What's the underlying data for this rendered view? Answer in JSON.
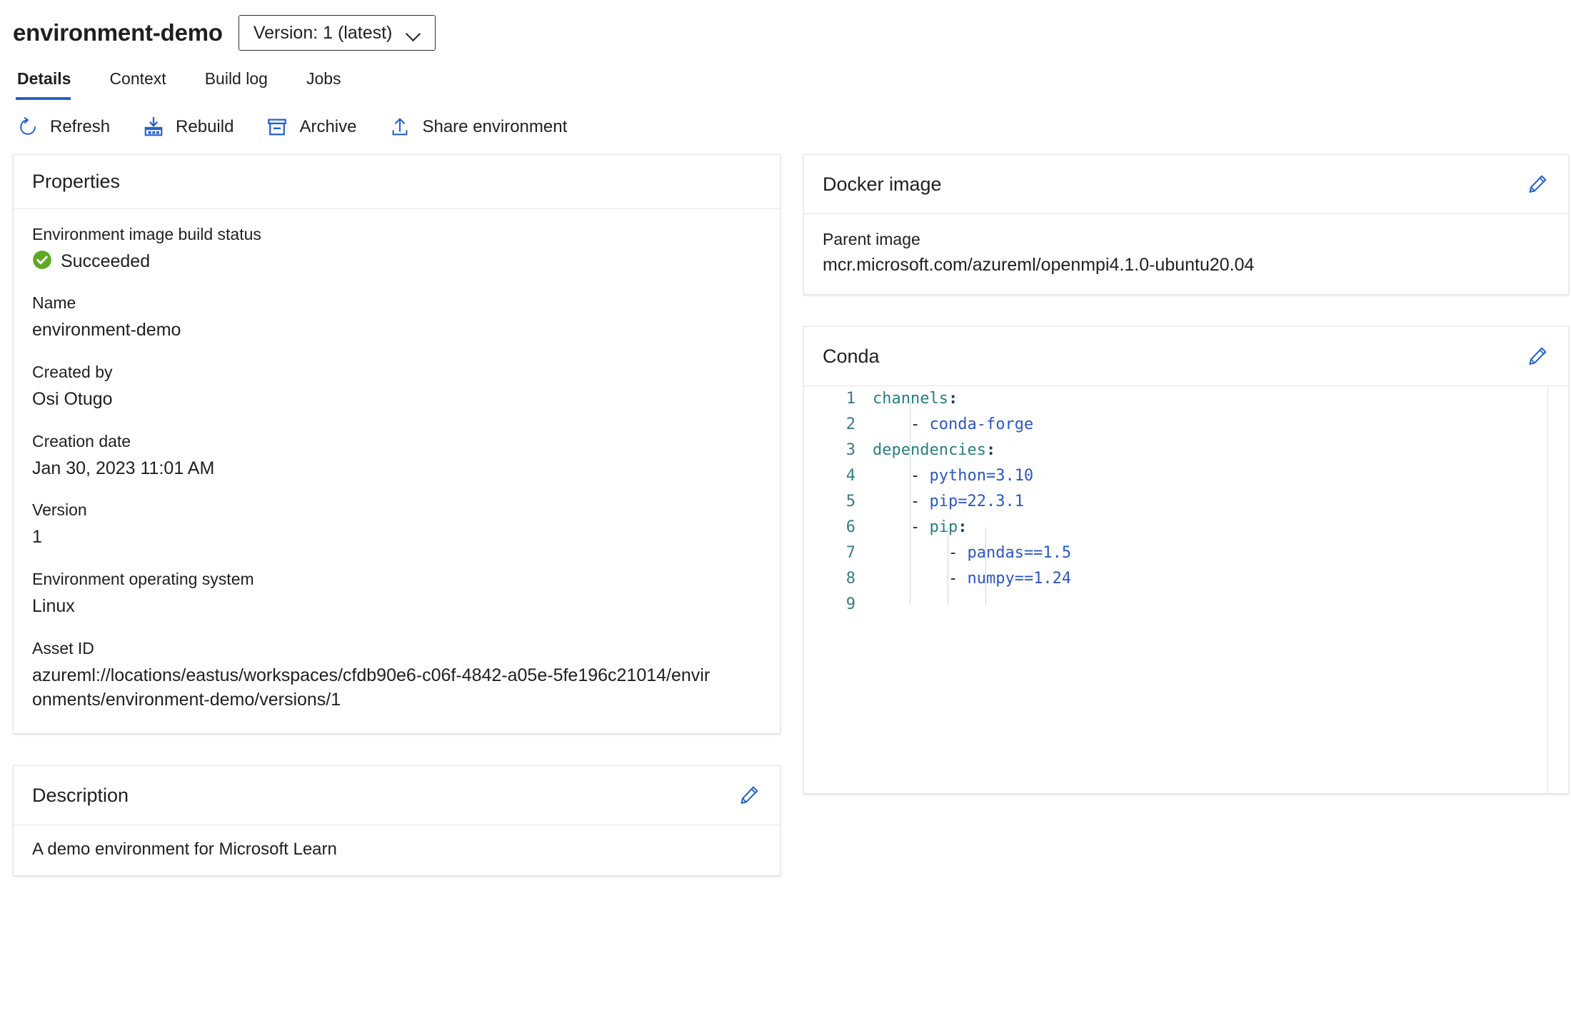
{
  "header": {
    "title": "environment-demo",
    "version_selector": {
      "label": "Version: 1 (latest)",
      "icon": "chevron-down-icon"
    }
  },
  "tabs": [
    {
      "label": "Details",
      "active": true
    },
    {
      "label": "Context",
      "active": false
    },
    {
      "label": "Build log",
      "active": false
    },
    {
      "label": "Jobs",
      "active": false
    }
  ],
  "commandbar": [
    {
      "label": "Refresh",
      "icon": "refresh-icon"
    },
    {
      "label": "Rebuild",
      "icon": "rebuild-icon"
    },
    {
      "label": "Archive",
      "icon": "archive-icon"
    },
    {
      "label": "Share environment",
      "icon": "share-upload-icon"
    }
  ],
  "properties_card": {
    "title": "Properties",
    "fields": [
      {
        "label": "Environment image build status",
        "value": "Succeeded",
        "status": true,
        "status_color": "#5fa825",
        "status_icon": "check-circle-icon"
      },
      {
        "label": "Name",
        "value": "environment-demo"
      },
      {
        "label": "Created by",
        "value": "Osi Otugo"
      },
      {
        "label": "Creation date",
        "value": "Jan 30, 2023 11:01 AM"
      },
      {
        "label": "Version",
        "value": "1"
      },
      {
        "label": "Environment operating system",
        "value": "Linux"
      },
      {
        "label": "Asset ID",
        "value": "azureml://locations/eastus/workspaces/cfdb90e6-c06f-4842-a05e-5fe196c21014/environments/environment-demo/versions/1",
        "wrap": true
      }
    ]
  },
  "docker_card": {
    "title": "Docker image",
    "edit_icon": "pencil-icon",
    "parent_image_label": "Parent image",
    "parent_image_value": "mcr.microsoft.com/azureml/openmpi4.1.0-ubuntu20.04"
  },
  "conda_card": {
    "title": "Conda",
    "edit_icon": "pencil-icon",
    "lines": [
      {
        "n": "1",
        "indent": 0,
        "key": "channels",
        "colon": ":",
        "dash": false,
        "value": ""
      },
      {
        "n": "2",
        "indent": 1,
        "key": "",
        "colon": "",
        "dash": true,
        "value": "conda-forge"
      },
      {
        "n": "3",
        "indent": 0,
        "key": "dependencies",
        "colon": ":",
        "dash": false,
        "value": ""
      },
      {
        "n": "4",
        "indent": 1,
        "key": "",
        "colon": "",
        "dash": true,
        "value": "python=3.10"
      },
      {
        "n": "5",
        "indent": 1,
        "key": "",
        "colon": "",
        "dash": true,
        "value": "pip=22.3.1"
      },
      {
        "n": "6",
        "indent": 1,
        "key": "pip",
        "colon": ":",
        "dash": true,
        "value": ""
      },
      {
        "n": "7",
        "indent": 2,
        "key": "",
        "colon": "",
        "dash": true,
        "value": "pandas==1.5"
      },
      {
        "n": "8",
        "indent": 2,
        "key": "",
        "colon": "",
        "dash": true,
        "value": "numpy==1.24"
      },
      {
        "n": "9",
        "indent": 0,
        "key": "",
        "colon": "",
        "dash": false,
        "value": ""
      }
    ]
  },
  "description_card": {
    "title": "Description",
    "edit_icon": "pencil-icon",
    "text": "A demo environment for Microsoft Learn"
  },
  "colors": {
    "accent": "#2563c9",
    "success": "#5fa825",
    "text": "#201f1e",
    "border": "#e6e6e6",
    "code_key": "#267f7f",
    "code_value": "#2b57c4",
    "code_lineno": "#3b7a82"
  }
}
